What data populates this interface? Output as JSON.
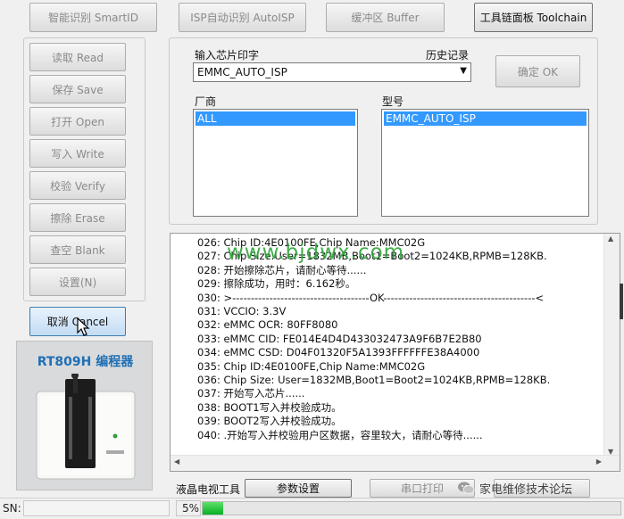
{
  "top_buttons": [
    {
      "label": "智能识别 SmartID"
    },
    {
      "label": "ISP自动识别 AutoISP"
    },
    {
      "label": "缓冲区 Buffer"
    },
    {
      "label": "工具链面板 Toolchain"
    }
  ],
  "left_buttons": [
    {
      "label": "读取 Read"
    },
    {
      "label": "保存 Save"
    },
    {
      "label": "打开 Open"
    },
    {
      "label": "写入 Write"
    },
    {
      "label": "校验 Verify"
    },
    {
      "label": "擦除 Erase"
    },
    {
      "label": "查空 Blank"
    },
    {
      "label": "设置(N)"
    }
  ],
  "cancel_button": "取消 Cancel",
  "device_panel": {
    "title": "RT809H 编程器"
  },
  "chip_input": {
    "label": "输入芯片印字",
    "history_label": "历史记录",
    "value": "EMMC_AUTO_ISP"
  },
  "confirm_button": "确定 OK",
  "vendor": {
    "label": "厂商",
    "items": [
      "ALL"
    ]
  },
  "model": {
    "label": "型号",
    "items": [
      "EMMC_AUTO_ISP"
    ]
  },
  "watermark": "www.bjdwx.com",
  "log_lines": [
    "026:  Chip ID:4E0100FE,Chip Name:MMC02G",
    "027:  Chip Size:User=1832MB,Boot1=Boot2=1024KB,RPMB=128KB.",
    "028:  开始擦除芯片，请耐心等待......",
    "029:  擦除成功，用时：6.162秒。",
    "030:  >-------------------------------------OK-----------------------------------------<",
    "031:  VCCIO: 3.3V",
    "032:  eMMC OCR: 80FF8080",
    "033:  eMMC CID:  FE014E4D4D433032473A9F6B7E2B80",
    "034:  eMMC CSD: D04F01320F5A1393FFFFFFE38A4000",
    "035:  Chip ID:4E0100FE,Chip Name:MMC02G",
    "036:  Chip Size: User=1832MB,Boot1=Boot2=1024KB,RPMB=128KB.",
    "037:  开始写入芯片......",
    "038:  BOOT1写入并校验成功。",
    "039:  BOOT2写入并校验成功。",
    "040:  .开始写入并校验用户区数据，容里较大，请耐心等待......"
  ],
  "bottom_toolbar": {
    "tv_tools_label": "液晶电视工具",
    "param_button": "参数设置",
    "serial_button": "串口打印",
    "forum_text": "家电维修技术论坛"
  },
  "status": {
    "sn_label": "SN:",
    "progress_text": "5%",
    "progress_value": 0.05
  },
  "colors": {
    "accent": "#3399ff",
    "progress": "#06b025",
    "watermark": "#2ea63a",
    "device_title": "#1f6fb5"
  }
}
